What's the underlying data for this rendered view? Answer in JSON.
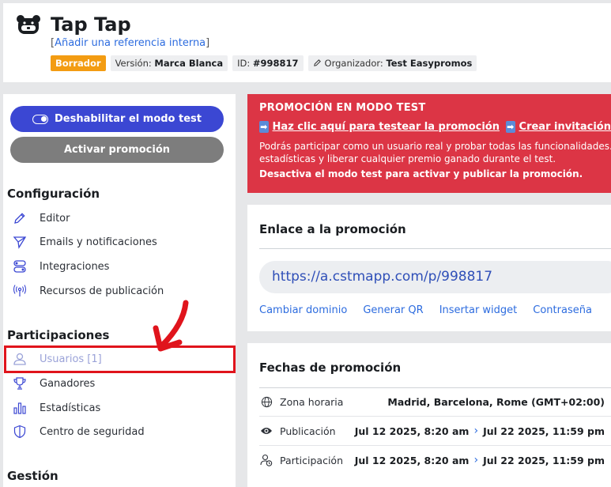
{
  "header": {
    "title": "Tap Tap",
    "internal_ref_open": "[",
    "internal_ref_label": "Añadir una referencia interna",
    "internal_ref_close": "]",
    "status_badge": "Borrador",
    "version_label": "Versión:",
    "version_value": "Marca Blanca",
    "id_label": "ID:",
    "id_value": "#998817",
    "organizer_label": "Organizador:",
    "organizer_value": "Test Easypromos"
  },
  "sidebar": {
    "disable_test_button": "Deshabilitar el modo test",
    "activate_button": "Activar promoción",
    "config_title": "Configuración",
    "config_items": [
      {
        "label": "Editor",
        "icon": "pencil-icon"
      },
      {
        "label": "Emails y notificaciones",
        "icon": "send-icon"
      },
      {
        "label": "Integraciones",
        "icon": "integrations-icon"
      },
      {
        "label": "Recursos de publicación",
        "icon": "broadcast-icon"
      }
    ],
    "participations_title": "Participaciones",
    "participation_items": [
      {
        "label": "Usuarios [1]",
        "icon": "user-icon"
      },
      {
        "label": "Ganadores",
        "icon": "trophy-icon"
      },
      {
        "label": "Estadísticas",
        "icon": "bar-chart-icon"
      },
      {
        "label": "Centro de seguridad",
        "icon": "shield-icon"
      }
    ],
    "management_title": "Gestión"
  },
  "test_banner": {
    "title": "PROMOCIÓN EN MODO TEST",
    "link_test": "Haz clic aquí para testear la promoción",
    "link_invite": "Crear invitación",
    "description_1": "Podrás participar como un usuario real y probar todas las funcionalidades.",
    "description_2": "estadísticas y liberar cualquier premio ganado durante el test.",
    "cta": "Desactiva el modo test para activar y publicar la promoción.",
    "arrow_glyph": "➡"
  },
  "link_card": {
    "title": "Enlace a la promoción",
    "url": "https://a.cstmapp.com/p/998817",
    "actions": [
      "Cambiar dominio",
      "Generar QR",
      "Insertar widget",
      "Contraseña"
    ]
  },
  "dates_card": {
    "title": "Fechas de promoción",
    "timezone_label": "Zona horaria",
    "timezone_value": "Madrid, Barcelona, Rome (GMT+02:00)",
    "publication_label": "Publicación",
    "publication_start": "Jul 12 2025, 8:20 am",
    "publication_end": "Jul 22 2025, 11:59 pm",
    "participation_label": "Participación",
    "participation_start": "Jul 12 2025, 8:20 am",
    "participation_end": "Jul 22 2025, 11:59 pm",
    "separator": "›"
  },
  "colors": {
    "primary": "#3b47d3",
    "danger": "#dc3545",
    "draft": "#f39c12",
    "highlight": "#e0141c"
  }
}
